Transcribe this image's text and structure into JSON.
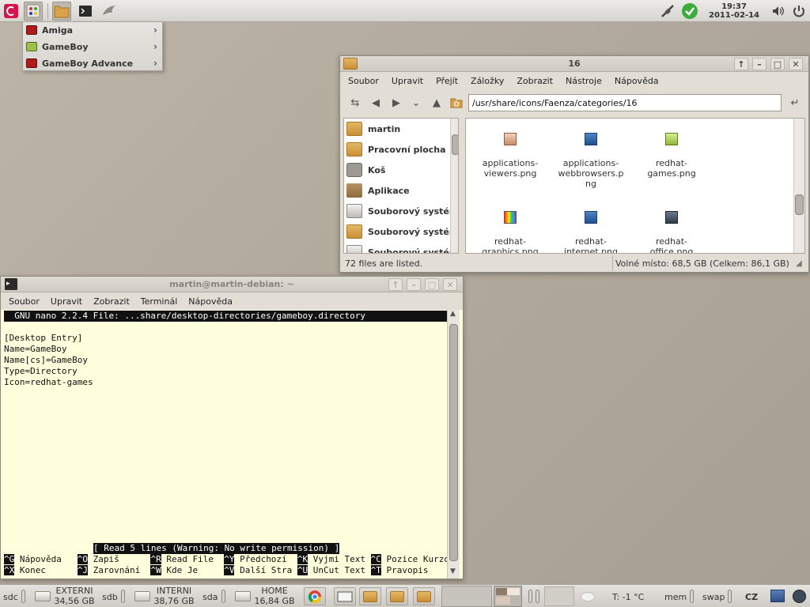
{
  "top_panel": {
    "clock_time": "19:37",
    "clock_date": "2011-02-14"
  },
  "app_menu": {
    "items": [
      {
        "label": "Amiga",
        "icon": "amiga-icon"
      },
      {
        "label": "GameBoy",
        "icon": "gameboy-icon"
      },
      {
        "label": "GameBoy Advance",
        "icon": "gameboy-advance-icon"
      }
    ]
  },
  "file_manager": {
    "title": "16",
    "menu": [
      "Soubor",
      "Upravit",
      "Přejít",
      "Záložky",
      "Zobrazit",
      "Nástroje",
      "Nápověda"
    ],
    "location": "/usr/share/icons/Faenza/categories/16",
    "sidebar": [
      "martin",
      "Pracovní plocha",
      "Koš",
      "Aplikace",
      "Souborový systém",
      "Souborový systém",
      "Souborový systém"
    ],
    "files": [
      {
        "name_line1": "applications-",
        "name_line2": "viewers.png",
        "name_line3": ""
      },
      {
        "name_line1": "applications-",
        "name_line2": "webbrowsers.p",
        "name_line3": "ng"
      },
      {
        "name_line1": "redhat-",
        "name_line2": "games.png",
        "name_line3": ""
      },
      {
        "name_line1": "redhat-",
        "name_line2": "graphics.png",
        "name_line3": ""
      },
      {
        "name_line1": "redhat-",
        "name_line2": "internet.png",
        "name_line3": ""
      },
      {
        "name_line1": "redhat-",
        "name_line2": "office.png",
        "name_line3": ""
      }
    ],
    "status_left": "72 files are listed.",
    "status_right": "Volné místo: 68,5 GB (Celkem: 86,1 GB)"
  },
  "terminal": {
    "title": "martin@martin-debian: ~",
    "menu": [
      "Soubor",
      "Upravit",
      "Zobrazit",
      "Terminál",
      "Nápověda"
    ],
    "nano_header": "  GNU nano 2.2.4 File: ...share/desktop-directories/gameboy.directory       ",
    "lines": [
      "[Desktop Entry]",
      "Name=GameBoy",
      "Name[cs]=GameBoy",
      "Type=Directory",
      "Icon=redhat-games"
    ],
    "message": "[ Read 5 lines (Warning: No write permission) ]",
    "shortcuts_row1": [
      {
        "key": "^G",
        "label": " Nápověda   "
      },
      {
        "key": "^O",
        "label": " Zapiš      "
      },
      {
        "key": "^R",
        "label": " Read File  "
      },
      {
        "key": "^Y",
        "label": " Předchozí  "
      },
      {
        "key": "^K",
        "label": " Vyjmi Text "
      },
      {
        "key": "^C",
        "label": " Pozice Kurzo"
      }
    ],
    "shortcuts_row2": [
      {
        "key": "^X",
        "label": " Konec      "
      },
      {
        "key": "^J",
        "label": " Zarovnání  "
      },
      {
        "key": "^W",
        "label": " Kde Je     "
      },
      {
        "key": "^V",
        "label": " Další Stra "
      },
      {
        "key": "^U",
        "label": " UnCut Text "
      },
      {
        "key": "^T",
        "label": " Pravopis"
      }
    ]
  },
  "bottom_panel": {
    "devices": [
      {
        "id": "sdc",
        "name": "EXTERNI",
        "size": "34,56 GB"
      },
      {
        "id": "sdb",
        "name": "INTERNI",
        "size": "38,76 GB"
      },
      {
        "id": "sda",
        "name": "HOME",
        "size": "16,84 GB"
      }
    ],
    "temperature": "T: -1 °C",
    "mem_label": "mem",
    "swap_label": "swap",
    "keyboard_layout": "CZ"
  },
  "colors": {
    "desktop": "#b3ab9d",
    "terminal_bg": "#ffffdd",
    "folder": "#d9a24a"
  }
}
